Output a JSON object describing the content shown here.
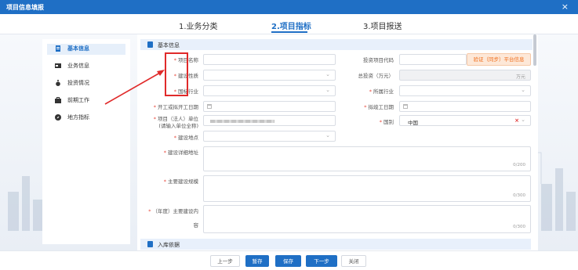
{
  "window": {
    "title": "项目信息填报",
    "close_glyph": "×"
  },
  "steps": [
    {
      "label": "1.业务分类",
      "active": false
    },
    {
      "label": "2.项目指标",
      "active": true
    },
    {
      "label": "3.项目报送",
      "active": false
    }
  ],
  "sidebar": {
    "items": [
      {
        "label": "基本信息",
        "icon": "document-icon",
        "active": true
      },
      {
        "label": "业务信息",
        "icon": "card-icon",
        "active": false
      },
      {
        "label": "投资情况",
        "icon": "money-bag-icon",
        "active": false
      },
      {
        "label": "前期工作",
        "icon": "briefcase-icon",
        "active": false
      },
      {
        "label": "地方指标",
        "icon": "compass-icon",
        "active": false
      }
    ]
  },
  "sections": {
    "basic": "基本信息",
    "storage": "入库依据"
  },
  "form": {
    "required_mark": "*",
    "project_name_label": "项目名称",
    "project_code_label": "投资项目代码",
    "verify_button": "验证（同步）平台信息",
    "construction_nature_label": "建设性质",
    "total_investment_label": "总投资（万元）",
    "total_investment_unit": "万元",
    "national_industry_label": "国标行业",
    "industry_label": "所属行业",
    "start_date_label": "开工或拟开工日期",
    "completion_date_label": "拟竣工日期",
    "legal_unit_label_line1": "项目（法人）单位",
    "legal_unit_label_line2": "(请输入单位全称)",
    "country_label": "国别",
    "country_value": "中国",
    "country_clear": "×",
    "location_label": "建设地点",
    "address_label": "建设详细地址",
    "address_counter": "0/200",
    "scale_label": "主要建设规模",
    "scale_counter": "0/300",
    "content_label_line1": "（年度）主要建设内",
    "content_label_line2": "容",
    "content_counter": "0/300",
    "dropdown_glyph": "⌄"
  },
  "footer": {
    "prev": "上一步",
    "save_draft": "暂存",
    "save": "保存",
    "next": "下一步",
    "close": "关闭"
  },
  "colors": {
    "primary": "#1f6fc5",
    "required": "#e8493c",
    "annotation": "#e02a2a",
    "verify": "#f06d1a"
  }
}
